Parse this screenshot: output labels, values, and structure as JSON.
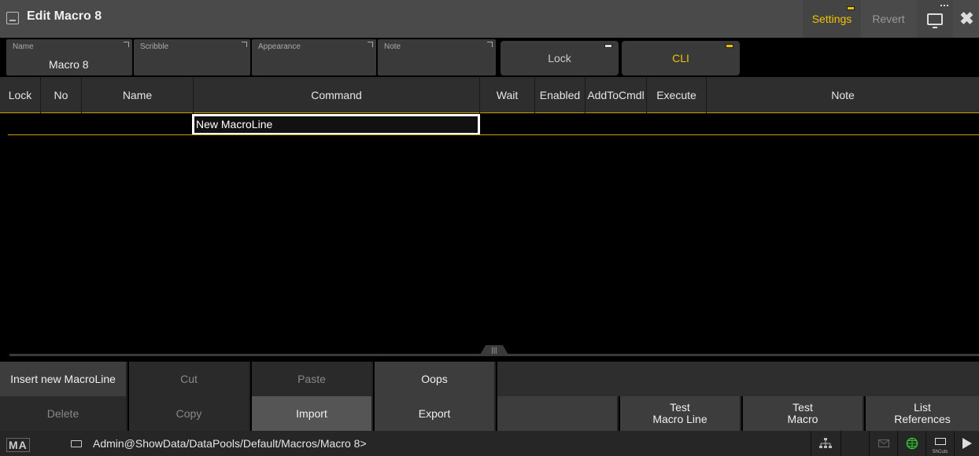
{
  "window": {
    "title": "Edit Macro 8"
  },
  "toolbar": {
    "settings_label": "Settings",
    "revert_label": "Revert"
  },
  "properties": {
    "name": {
      "label": "Name",
      "value": "Macro 8"
    },
    "scribble": {
      "label": "Scribble",
      "value": ""
    },
    "appearance": {
      "label": "Appearance",
      "value": ""
    },
    "note": {
      "label": "Note",
      "value": ""
    },
    "lock_label": "Lock",
    "cli_label": "CLI"
  },
  "table": {
    "headers": [
      "Lock",
      "No",
      "Name",
      "Command",
      "Wait",
      "Enabled",
      "AddToCmdl",
      "Execute",
      "Note"
    ],
    "editing_cell": "New MacroLine"
  },
  "actions": {
    "row1": [
      "Insert new MacroLine",
      "Cut",
      "Paste",
      "Oops"
    ],
    "row2": [
      "Delete",
      "Copy",
      "Import",
      "Export",
      "",
      "Test\nMacro Line",
      "Test\nMacro",
      "List\nReferences"
    ]
  },
  "statusbar": {
    "logo": "MA",
    "path": "Admin@ShowData/DataPools/Default/Macros/Macro 8>",
    "shortcuts_label": "ShCuts"
  },
  "colors": {
    "accent": "#f2c200",
    "background": "#000000"
  }
}
